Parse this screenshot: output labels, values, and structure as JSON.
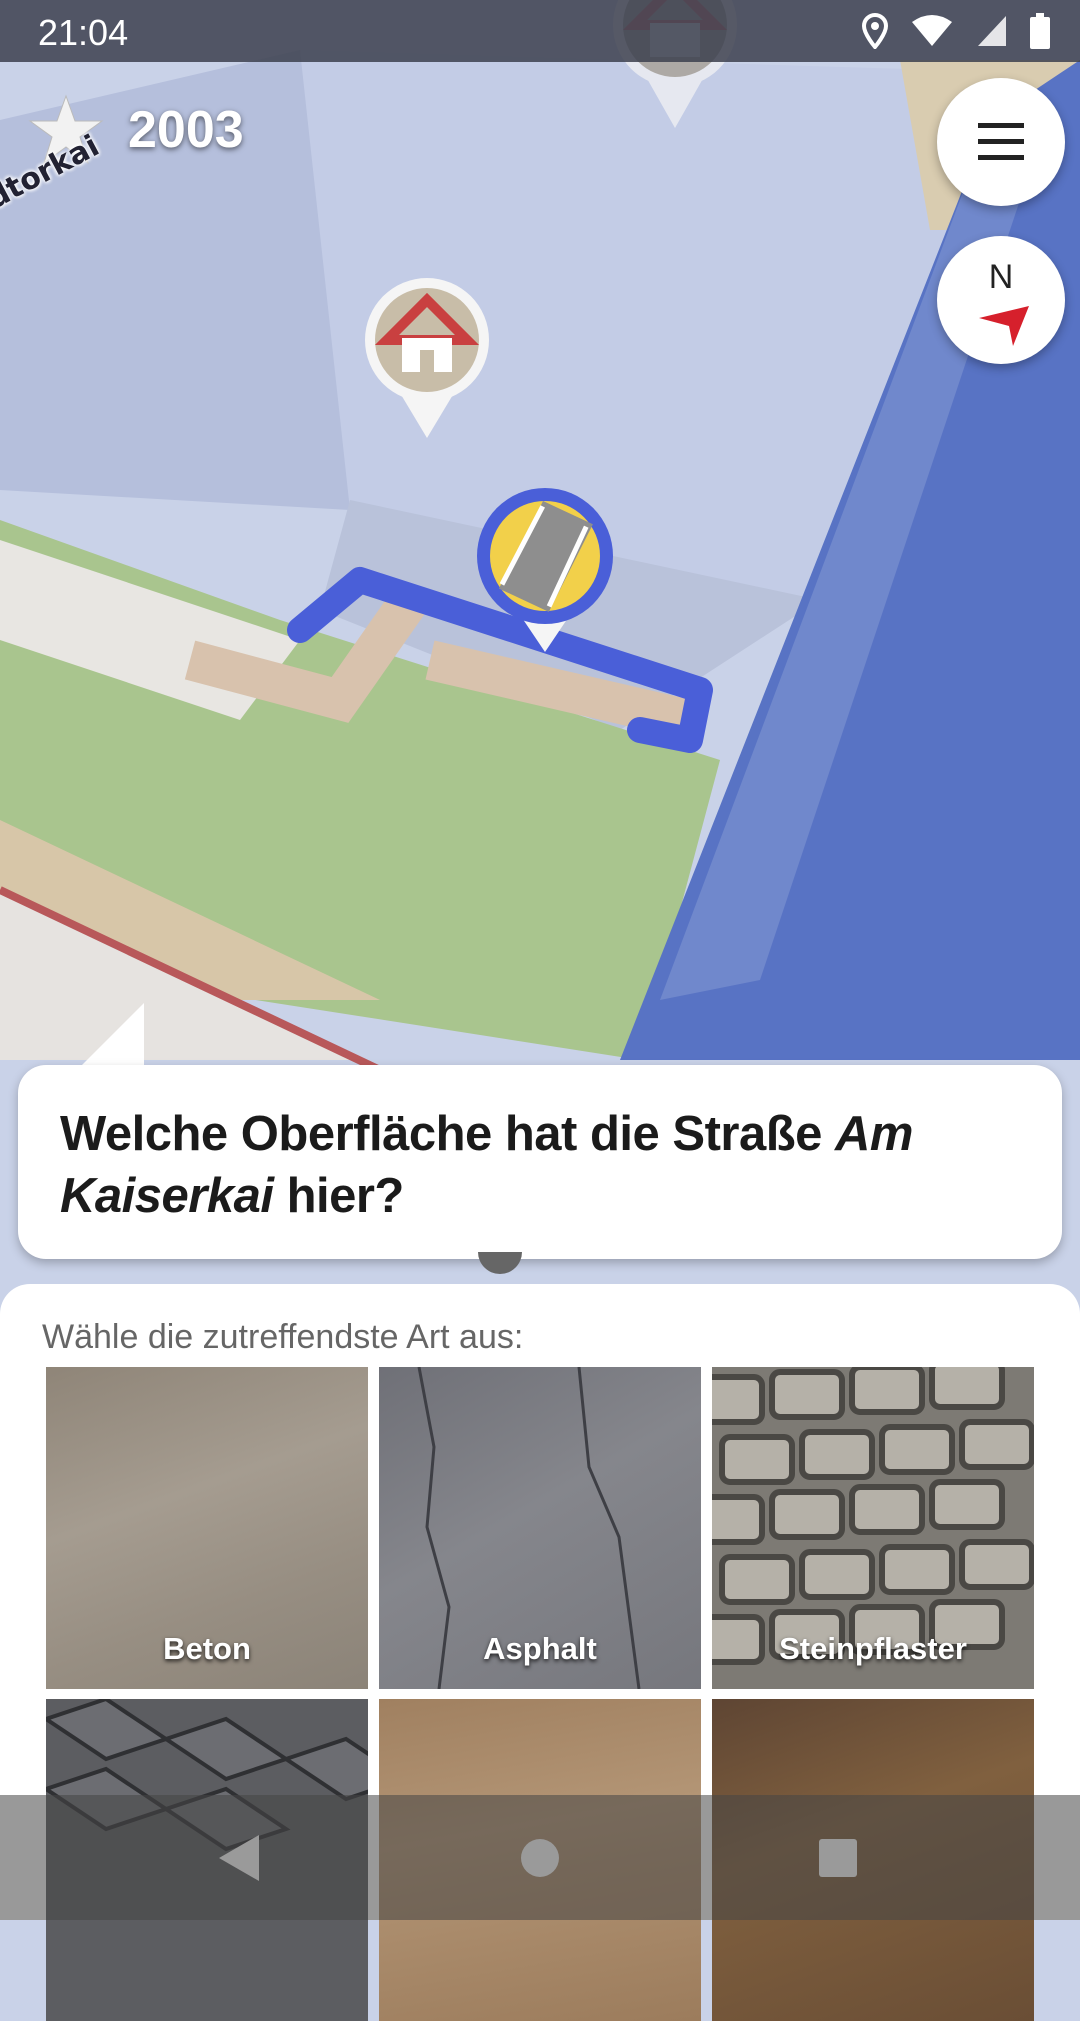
{
  "status_bar": {
    "time": "21:04",
    "icons": [
      "location-icon",
      "wifi-icon",
      "signal-icon",
      "battery-icon"
    ]
  },
  "header": {
    "score": "2003",
    "street_label": "ndtorkai"
  },
  "map": {
    "markers": [
      "house-marker",
      "house-marker",
      "surface-quest-marker"
    ],
    "controls": {
      "menu_icon": "hamburger-menu-icon",
      "compass_label": "N"
    }
  },
  "quest": {
    "question_prefix": "Welche Oberfläche hat die Straße ",
    "question_name": "Am Kaiserkai",
    "question_suffix": " hier?",
    "hint": "Wähle die zutreffendste Art aus:"
  },
  "options": [
    {
      "label": "Beton"
    },
    {
      "label": "Asphalt"
    },
    {
      "label": "Steinpflaster"
    },
    {
      "label": ""
    },
    {
      "label": ""
    },
    {
      "label": ""
    }
  ],
  "nav_bar": {
    "buttons": [
      "back-icon",
      "home-icon",
      "recents-icon"
    ]
  },
  "colors": {
    "accent_blue": "#4a5fd8",
    "quest_yellow": "#f2d04a",
    "water": "#5873c4",
    "grass": "#a9c58e"
  }
}
